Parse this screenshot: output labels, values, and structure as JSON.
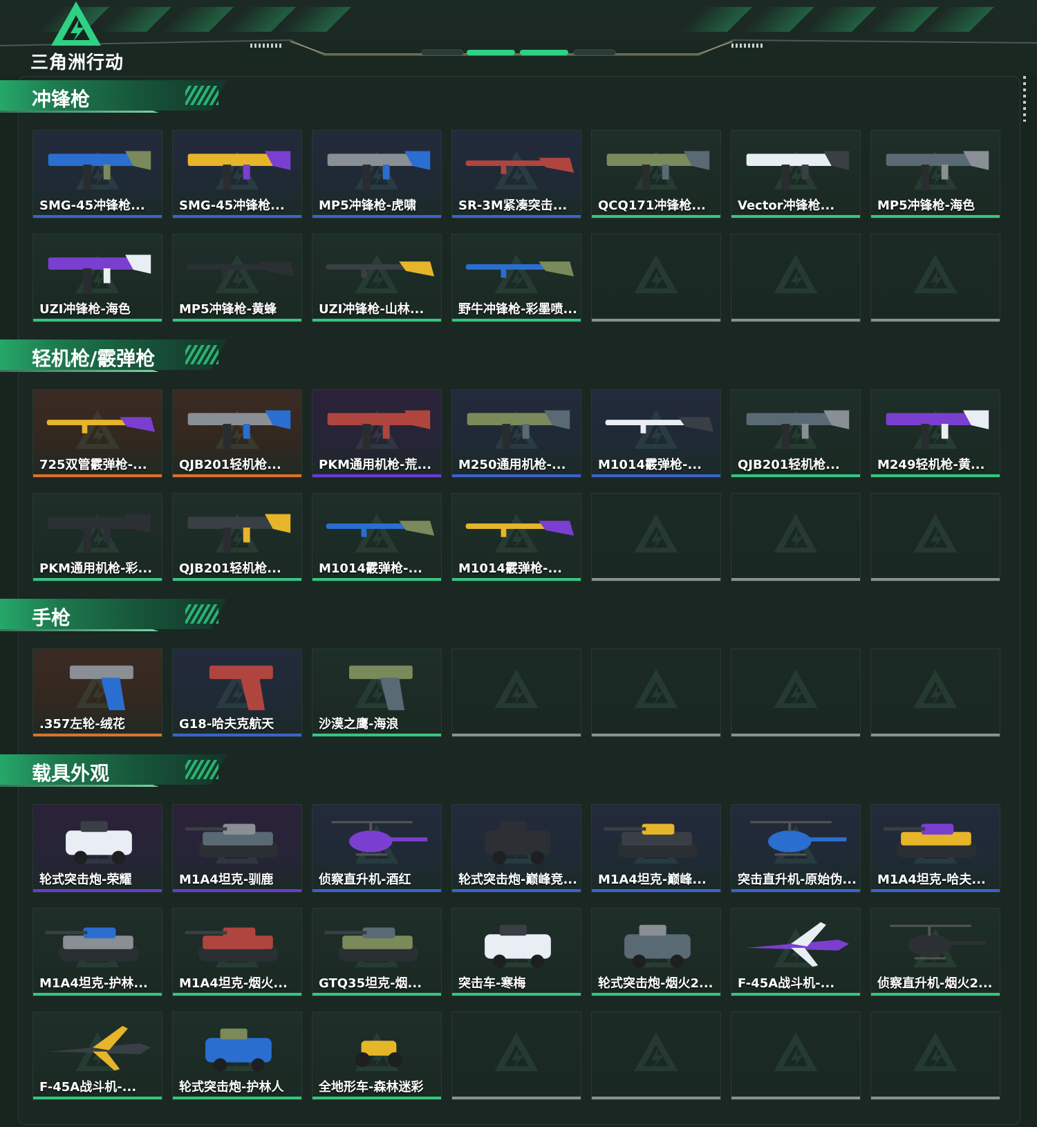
{
  "brand": {
    "name": "三角洲行动"
  },
  "colors": {
    "rarity_green": "#35c67f",
    "rarity_blue": "#3a62d0",
    "rarity_purple": "#6a3bd6",
    "rarity_orange": "#e0702a",
    "rarity_gray": "#8a918e",
    "accent": "#2fd184"
  },
  "sections": [
    {
      "title": "冲锋枪",
      "items": [
        {
          "label": "SMG-45冲锋枪...",
          "rarity": "blue",
          "icon": "smg-icon"
        },
        {
          "label": "SMG-45冲锋枪...",
          "rarity": "blue",
          "icon": "smg-icon"
        },
        {
          "label": "MP5冲锋枪-虎啸",
          "rarity": "blue",
          "icon": "smg-icon"
        },
        {
          "label": "SR-3M紧凑突击...",
          "rarity": "blue",
          "icon": "rifle-icon"
        },
        {
          "label": "QCQ171冲锋枪...",
          "rarity": "green",
          "icon": "smg-icon"
        },
        {
          "label": "Vector冲锋枪...",
          "rarity": "green",
          "icon": "smg-icon"
        },
        {
          "label": "MP5冲锋枪-海色",
          "rarity": "green",
          "icon": "smg-icon"
        },
        {
          "label": "UZI冲锋枪-海色",
          "rarity": "green",
          "icon": "smg-icon"
        },
        {
          "label": "MP5冲锋枪-黄蜂",
          "rarity": "green",
          "icon": "rifle-icon"
        },
        {
          "label": "UZI冲锋枪-山林...",
          "rarity": "green",
          "icon": "rifle-icon"
        },
        {
          "label": "野牛冲锋枪-彩墨喷...",
          "rarity": "green",
          "icon": "rifle-icon"
        },
        {
          "label": "",
          "rarity": "empty",
          "icon": ""
        },
        {
          "label": "",
          "rarity": "empty",
          "icon": ""
        },
        {
          "label": "",
          "rarity": "empty",
          "icon": ""
        }
      ]
    },
    {
      "title": "轻机枪/霰弹枪",
      "items": [
        {
          "label": "725双管霰弹枪-...",
          "rarity": "orange",
          "icon": "shotgun-icon"
        },
        {
          "label": "QJB201轻机枪...",
          "rarity": "orange",
          "icon": "machine-gun-icon"
        },
        {
          "label": "PKM通用机枪-荒...",
          "rarity": "purple",
          "icon": "machine-gun-icon"
        },
        {
          "label": "M250通用机枪-...",
          "rarity": "blue",
          "icon": "machine-gun-icon"
        },
        {
          "label": "M1014霰弹枪-...",
          "rarity": "blue",
          "icon": "shotgun-icon"
        },
        {
          "label": "QJB201轻机枪...",
          "rarity": "green",
          "icon": "machine-gun-icon"
        },
        {
          "label": "M249轻机枪-黄...",
          "rarity": "green",
          "icon": "machine-gun-icon"
        },
        {
          "label": "PKM通用机枪-彩...",
          "rarity": "green",
          "icon": "machine-gun-icon"
        },
        {
          "label": "QJB201轻机枪...",
          "rarity": "green",
          "icon": "machine-gun-icon"
        },
        {
          "label": "M1014霰弹枪-...",
          "rarity": "green",
          "icon": "shotgun-icon"
        },
        {
          "label": "M1014霰弹枪-...",
          "rarity": "green",
          "icon": "shotgun-icon"
        },
        {
          "label": "",
          "rarity": "empty",
          "icon": ""
        },
        {
          "label": "",
          "rarity": "empty",
          "icon": ""
        },
        {
          "label": "",
          "rarity": "empty",
          "icon": ""
        }
      ]
    },
    {
      "title": "手枪",
      "items": [
        {
          "label": ".357左轮-绒花",
          "rarity": "orange",
          "icon": "revolver-icon"
        },
        {
          "label": "G18-哈夫克航天",
          "rarity": "blue",
          "icon": "pistol-icon"
        },
        {
          "label": "沙漠之鹰-海浪",
          "rarity": "green",
          "icon": "pistol-icon"
        },
        {
          "label": "",
          "rarity": "empty",
          "icon": ""
        },
        {
          "label": "",
          "rarity": "empty",
          "icon": ""
        },
        {
          "label": "",
          "rarity": "empty",
          "icon": ""
        },
        {
          "label": "",
          "rarity": "empty",
          "icon": ""
        }
      ]
    },
    {
      "title": "载具外观",
      "items": [
        {
          "label": "轮式突击炮-荣耀",
          "rarity": "purple",
          "icon": "armored-car-icon"
        },
        {
          "label": "M1A4坦克-驯鹿",
          "rarity": "purple",
          "icon": "tank-icon"
        },
        {
          "label": "侦察直升机-酒红",
          "rarity": "blue",
          "icon": "helicopter-icon"
        },
        {
          "label": "轮式突击炮-巅峰竞...",
          "rarity": "blue",
          "icon": "armored-car-icon"
        },
        {
          "label": "M1A4坦克-巅峰...",
          "rarity": "blue",
          "icon": "tank-icon"
        },
        {
          "label": "突击直升机-原始伪...",
          "rarity": "blue",
          "icon": "helicopter-icon"
        },
        {
          "label": "M1A4坦克-哈夫...",
          "rarity": "blue",
          "icon": "tank-icon"
        },
        {
          "label": "M1A4坦克-护林...",
          "rarity": "green",
          "icon": "tank-icon"
        },
        {
          "label": "M1A4坦克-烟火...",
          "rarity": "green",
          "icon": "tank-icon"
        },
        {
          "label": "GTQ35坦克-烟...",
          "rarity": "green",
          "icon": "tank-icon"
        },
        {
          "label": "突击车-寒梅",
          "rarity": "green",
          "icon": "armored-car-icon"
        },
        {
          "label": "轮式突击炮-烟火2...",
          "rarity": "green",
          "icon": "armored-car-icon"
        },
        {
          "label": "F-45A战斗机-...",
          "rarity": "green",
          "icon": "jet-icon"
        },
        {
          "label": "侦察直升机-烟火2...",
          "rarity": "green",
          "icon": "helicopter-icon"
        },
        {
          "label": "F-45A战斗机-...",
          "rarity": "green",
          "icon": "jet-icon"
        },
        {
          "label": "轮式突击炮-护林人",
          "rarity": "green",
          "icon": "armored-car-icon"
        },
        {
          "label": "全地形车-森林迷彩",
          "rarity": "green",
          "icon": "atv-icon"
        },
        {
          "label": "",
          "rarity": "empty",
          "icon": ""
        },
        {
          "label": "",
          "rarity": "empty",
          "icon": ""
        },
        {
          "label": "",
          "rarity": "empty",
          "icon": ""
        },
        {
          "label": "",
          "rarity": "empty",
          "icon": ""
        }
      ]
    }
  ]
}
